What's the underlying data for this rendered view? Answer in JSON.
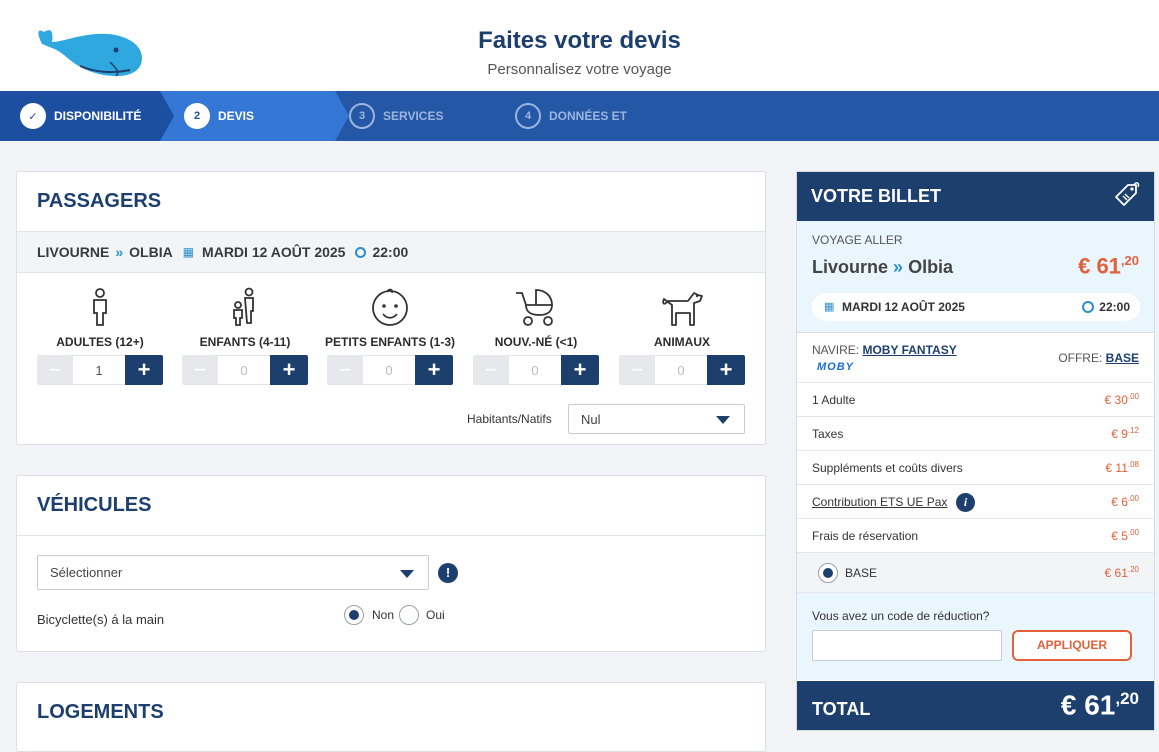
{
  "header": {
    "title": "Faites votre devis",
    "subtitle": "Personnalisez votre voyage"
  },
  "steps": [
    {
      "num": "✓",
      "label": "DISPONIBILITÉ"
    },
    {
      "num": "2",
      "label": "DEVIS"
    },
    {
      "num": "3",
      "label": "SERVICES"
    },
    {
      "num": "4",
      "label": "DONNÉES ET"
    }
  ],
  "passagers": {
    "title": "PASSAGERS",
    "route_from": "LIVOURNE",
    "route_to": "OLBIA",
    "date": "MARDI 12 AOÛT 2025",
    "time": "22:00",
    "types": [
      {
        "label": "ADULTES (12+)",
        "value": "1",
        "icon": "adult-icon"
      },
      {
        "label": "ENFANTS (4-11)",
        "value": "0",
        "icon": "child-icon"
      },
      {
        "label": "PETITS ENFANTS (1-3)",
        "value": "0",
        "icon": "baby-face-icon"
      },
      {
        "label": "NOUV.-NÉ (<1)",
        "value": "0",
        "icon": "stroller-icon"
      },
      {
        "label": "ANIMAUX",
        "value": "0",
        "icon": "dog-icon"
      }
    ],
    "minus": "−",
    "plus": "+",
    "habitants_label": "Habitants/Natifs",
    "habitants_value": "Nul"
  },
  "vehicules": {
    "title": "VÉHICULES",
    "select_value": "Sélectionner",
    "bicycle_label": "Bicyclette(s) á la main",
    "option_no": "Non",
    "option_yes": "Oui",
    "alert": "!"
  },
  "logements": {
    "title": "LOGEMENTS"
  },
  "billet": {
    "title": "VOTRE BILLET",
    "voyage_label": "VOYAGE ALLER",
    "from": "Livourne",
    "to": "Olbia",
    "price_int": "€ 61",
    "price_dec": ",20",
    "date": "MARDI 12 AOÛT 2025",
    "time": "22:00",
    "navire_label": "NAVIRE:",
    "navire_name": "MOBY FANTASY",
    "brand": "MOBY",
    "offre_label": "OFFRE:",
    "offre_value": "BASE",
    "lines": [
      {
        "label": "1 Adulte",
        "int": "€ 30",
        "dec": ".00"
      },
      {
        "label": "Taxes",
        "int": "€ 9",
        "dec": ".12"
      },
      {
        "label": "Suppléments et coûts divers",
        "int": "€ 11",
        "dec": ".08"
      },
      {
        "label": "Contribution ETS UE Pax",
        "int": "€ 6",
        "dec": ".00"
      },
      {
        "label": "Frais de réservation",
        "int": "€ 5",
        "dec": ".00"
      },
      {
        "label": "BASE",
        "int": "€ 61",
        "dec": ".20"
      }
    ],
    "promo_label": "Vous avez un code de réduction?",
    "promo_placeholder": "",
    "apply": "APPLIQUER",
    "total_label": "TOTAL",
    "total_int": "€ 61",
    "total_dec": ",20",
    "colors": {
      "navy": "#1d3f6e",
      "accent": "#e2603a",
      "light": "#e9f6fd"
    }
  }
}
